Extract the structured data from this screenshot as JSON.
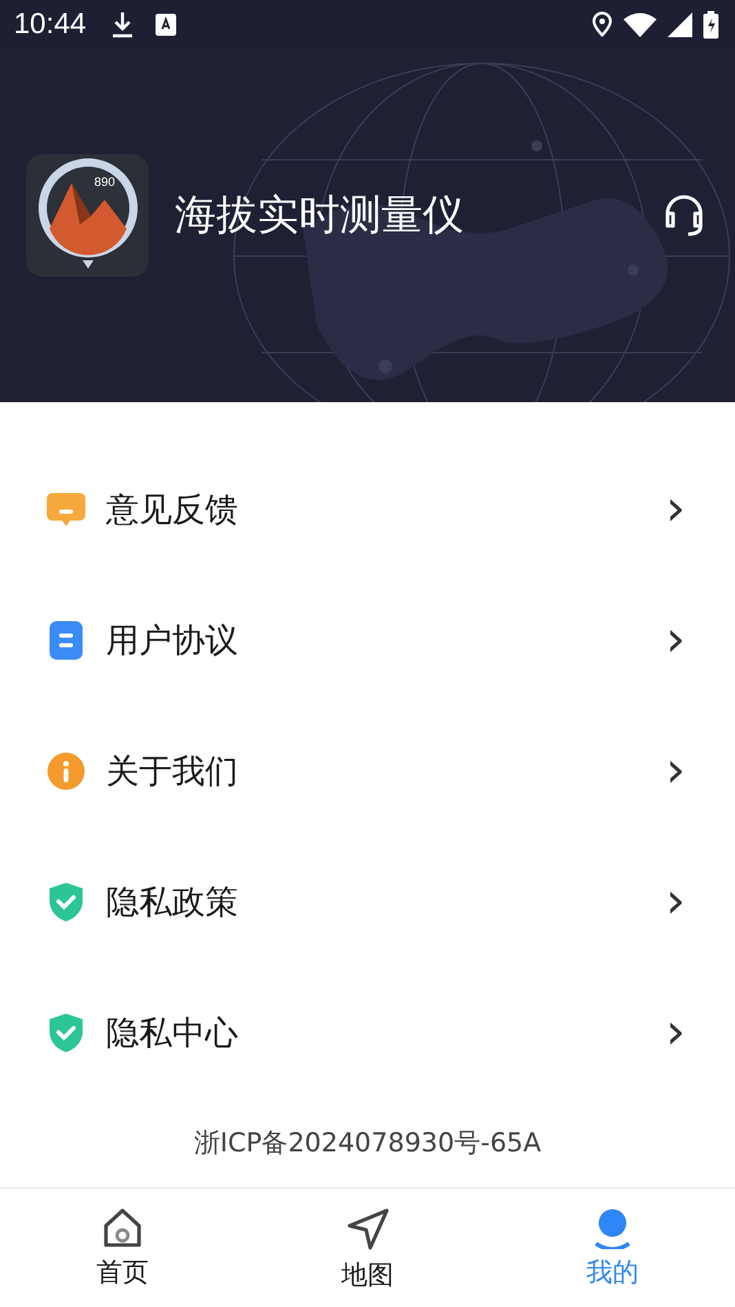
{
  "status_bar": {
    "time": "10:44"
  },
  "header": {
    "app_name": "海拔实时测量仪",
    "logo_reading": "890"
  },
  "menu": [
    {
      "kind": "feedback",
      "label": "意见反馈",
      "chevron": "›"
    },
    {
      "kind": "document",
      "label": "用户协议",
      "chevron": "›"
    },
    {
      "kind": "info",
      "label": "关于我们",
      "chevron": "›"
    },
    {
      "kind": "shield",
      "label": "隐私政策",
      "chevron": "›"
    },
    {
      "kind": "shield",
      "label": "隐私中心",
      "chevron": "›"
    }
  ],
  "footer": {
    "icp": "浙ICP备2024078930号-65A"
  },
  "bottom_nav": [
    {
      "kind": "home",
      "label": "首页",
      "selected": false
    },
    {
      "kind": "map",
      "label": "地图",
      "selected": false
    },
    {
      "kind": "profile",
      "label": "我的",
      "selected": true
    }
  ]
}
